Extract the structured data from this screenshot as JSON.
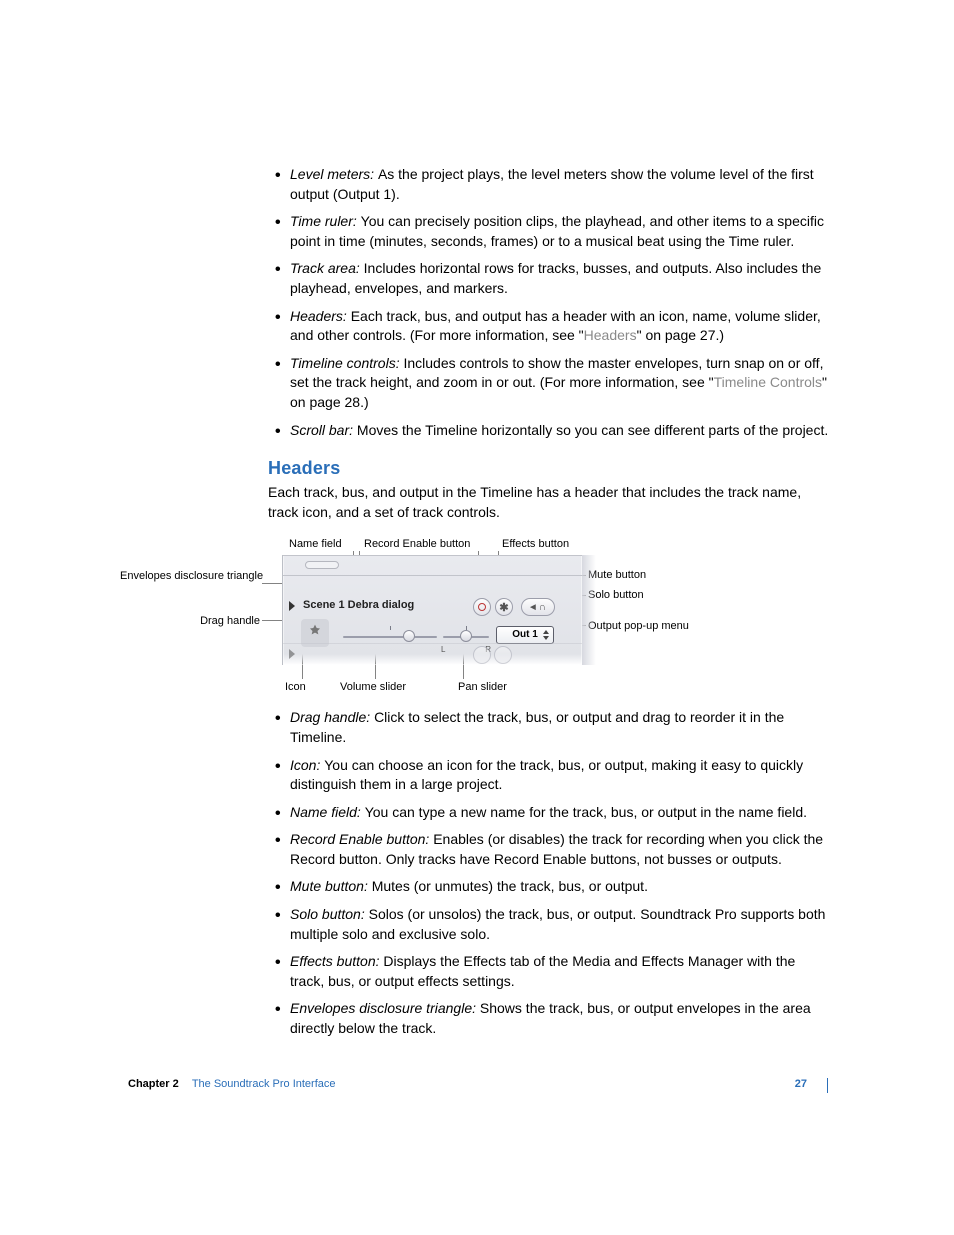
{
  "list_top": [
    {
      "term": "Level meters:",
      "body": "As the project plays, the level meters show the volume level of the first output (Output 1)."
    },
    {
      "term": "Time ruler:",
      "body": "You can precisely position clips, the playhead, and other items to a specific point in time (minutes, seconds, frames) or to a musical beat using the Time ruler."
    },
    {
      "term": "Track area:",
      "body": "Includes horizontal rows for tracks, busses, and outputs. Also includes the playhead, envelopes, and markers."
    },
    {
      "term": "Headers:",
      "body": "Each track, bus, and output has a header with an icon, name, volume slider, and other controls. (For more information, see \"",
      "link": "Headers",
      "body2": "\" on page 27.)"
    },
    {
      "term": "Timeline controls:",
      "body": "Includes controls to show the master envelopes, turn snap on or off, set the track height, and zoom in or out. (For more information, see \"",
      "link": "Timeline Controls",
      "body2": "\" on page 28.)"
    },
    {
      "term": "Scroll bar:",
      "body": "Moves the Timeline horizontally so you can see different parts of the project."
    }
  ],
  "heading": "Headers",
  "intro": "Each track, bus, and output in the Timeline has a header that includes the track name, track icon, and a set of track controls.",
  "diagram": {
    "nameField": "Name field",
    "recordEnable": "Record Enable button",
    "effectsBtn": "Effects button",
    "envelopes": "Envelopes disclosure triangle",
    "dragHandle": "Drag handle",
    "mute": "Mute button",
    "solo": "Solo button",
    "output": "Output pop-up menu",
    "icon": "Icon",
    "volume": "Volume slider",
    "pan": "Pan slider",
    "trackName": "Scene 1 Debra dialog",
    "outLabel": "Out 1"
  },
  "list_bottom": [
    {
      "term": "Drag handle:",
      "body": "Click to select the track, bus, or output and drag to reorder it in the Timeline."
    },
    {
      "term": "Icon:",
      "body": "You can choose an icon for the track, bus, or output, making it easy to quickly distinguish them in a large project."
    },
    {
      "term": "Name field:",
      "body": "You can type a new name for the track, bus, or output in the name field."
    },
    {
      "term": "Record Enable button:",
      "body": "Enables (or disables) the track for recording when you click the Record button. Only tracks have Record Enable buttons, not busses or outputs."
    },
    {
      "term": "Mute button:",
      "body": "Mutes (or unmutes) the track, bus, or output."
    },
    {
      "term": "Solo button:",
      "body": "Solos (or unsolos) the track, bus, or output. Soundtrack Pro supports both multiple solo and exclusive solo."
    },
    {
      "term": "Effects button:",
      "body": "Displays the Effects tab of the Media and Effects Manager with the track, bus, or output effects settings."
    },
    {
      "term": "Envelopes disclosure triangle:",
      "body": "Shows the track, bus, or output envelopes in the area directly below the track."
    }
  ],
  "footer": {
    "chapter": "Chapter 2",
    "title": "The Soundtrack Pro Interface",
    "page": "27"
  }
}
